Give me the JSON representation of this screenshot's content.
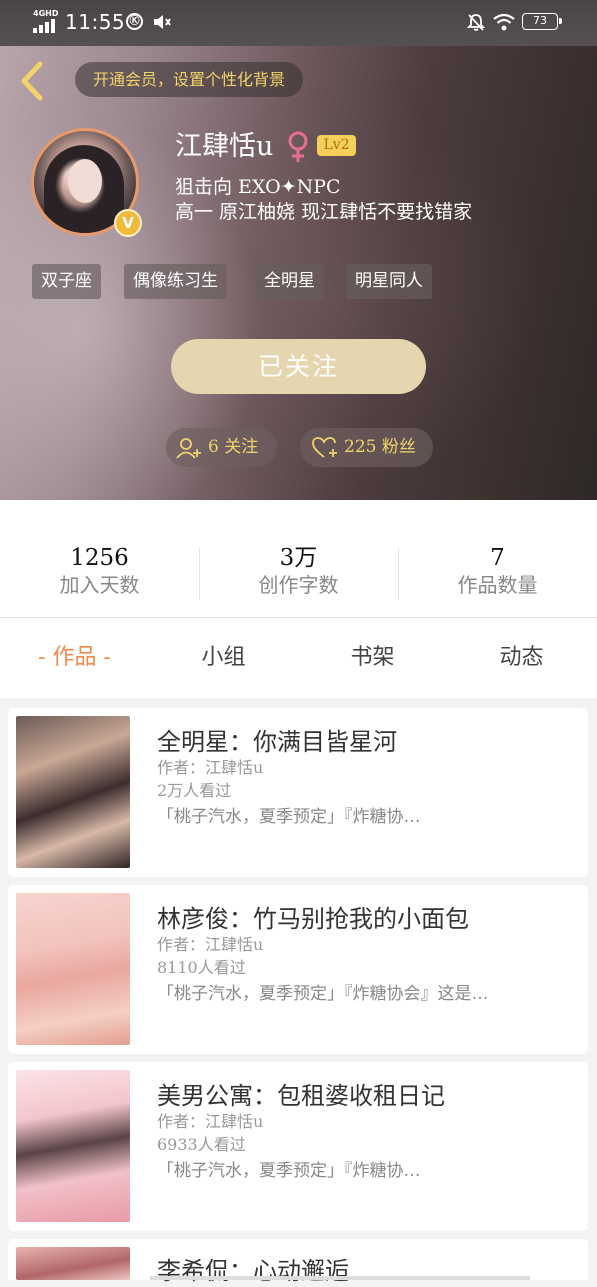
{
  "status_bar": {
    "network": "4GHD",
    "time": "11:55",
    "battery": "73"
  },
  "header": {
    "vip_prompt": "开通会员，设置个性化背景",
    "username": "江肆恬u",
    "gender_symbol": "♀",
    "level": "Lv2",
    "verified_badge": "V",
    "bio_line1": "狙击向 EXO✦NPC",
    "bio_line2": "高一 原江柚娆 现江肆恬不要找错家",
    "tags": [
      "双子座",
      "偶像练习生",
      "全明星",
      "明星同人"
    ],
    "follow_button": "已关注",
    "following_label": "6 关注",
    "followers_label": "225 粉丝"
  },
  "stats": [
    {
      "value": "1256",
      "label": "加入天数"
    },
    {
      "value": "3万",
      "label": "创作字数"
    },
    {
      "value": "7",
      "label": "作品数量"
    }
  ],
  "tabs": [
    {
      "label": "- 作品 -",
      "active": true
    },
    {
      "label": "小组",
      "active": false
    },
    {
      "label": "书架",
      "active": false
    },
    {
      "label": "动态",
      "active": false
    }
  ],
  "works": [
    {
      "title": "全明星：你满目皆星河",
      "author": "作者：江肆恬u",
      "views": "2万人看过",
      "desc": "「桃子汽水，夏季预定」『炸糖协…"
    },
    {
      "title": "林彦俊：竹马别抢我的小面包",
      "author": "作者：江肆恬u",
      "views": "8110人看过",
      "desc": "「桃子汽水，夏季预定」『炸糖协会』这是…"
    },
    {
      "title": "美男公寓：包租婆收租日记",
      "author": "作者：江肆恬u",
      "views": "6933人看过",
      "desc": "「桃子汽水，夏季预定」『炸糖协…"
    },
    {
      "title": "李希侃：心动邂逅",
      "author": "",
      "views": "",
      "desc": ""
    }
  ],
  "colors": {
    "accent_orange": "#f08a4b",
    "gold": "#f2d46a",
    "follow_button_bg": "#e6d6b0",
    "female_pink": "#e8708f"
  }
}
